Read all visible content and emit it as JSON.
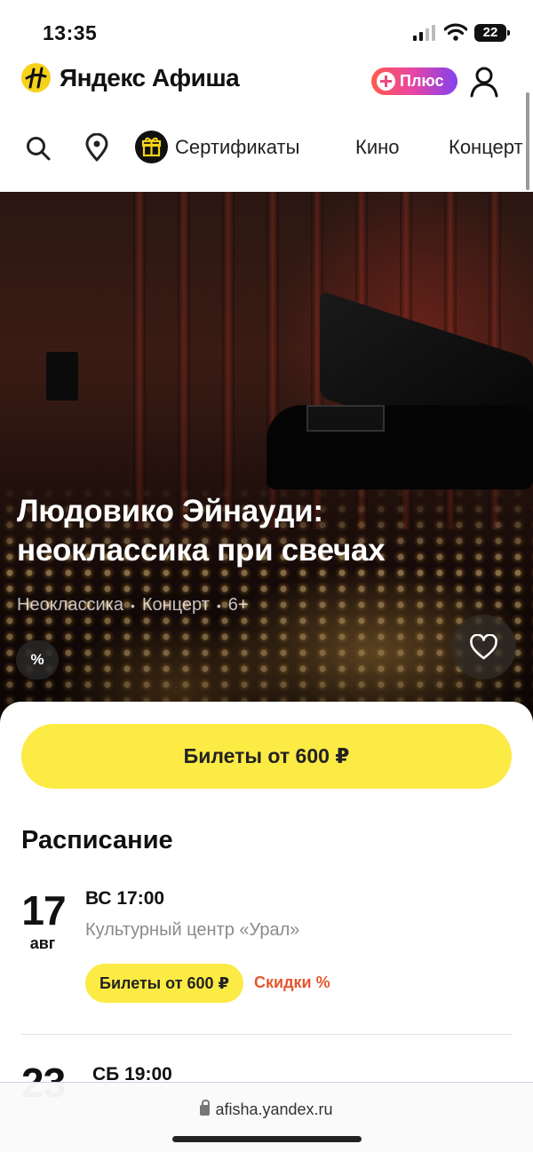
{
  "status_bar": {
    "time": "13:35",
    "battery": "22"
  },
  "header": {
    "logo_text": "Яндекс Афиша",
    "plus_label": "Плюс"
  },
  "nav": {
    "items": [
      "Сертификаты",
      "Кино",
      "Концерт"
    ]
  },
  "event": {
    "title": "Людовико Эйнауди: неоклассика при свечах",
    "meta": [
      "Неоклассика",
      "Концерт",
      "6+"
    ],
    "discount_badge": "%"
  },
  "buy_button": "Билеты от 600 ₽",
  "schedule": {
    "title": "Расписание",
    "entries": [
      {
        "day": "17",
        "month": "авг",
        "weekday_time": "ВС  17:00",
        "venue": "Культурный центр «Урал»",
        "price_button": "Билеты от 600 ₽",
        "sale": "Скидки %"
      },
      {
        "day": "23",
        "weekday_time": "СБ  19:00"
      }
    ]
  },
  "browser": {
    "url": "afisha.yandex.ru"
  },
  "colors": {
    "accent_yellow": "#fcea45",
    "sale_orange": "#e4572e",
    "brand_yellow": "#f7d21a"
  }
}
